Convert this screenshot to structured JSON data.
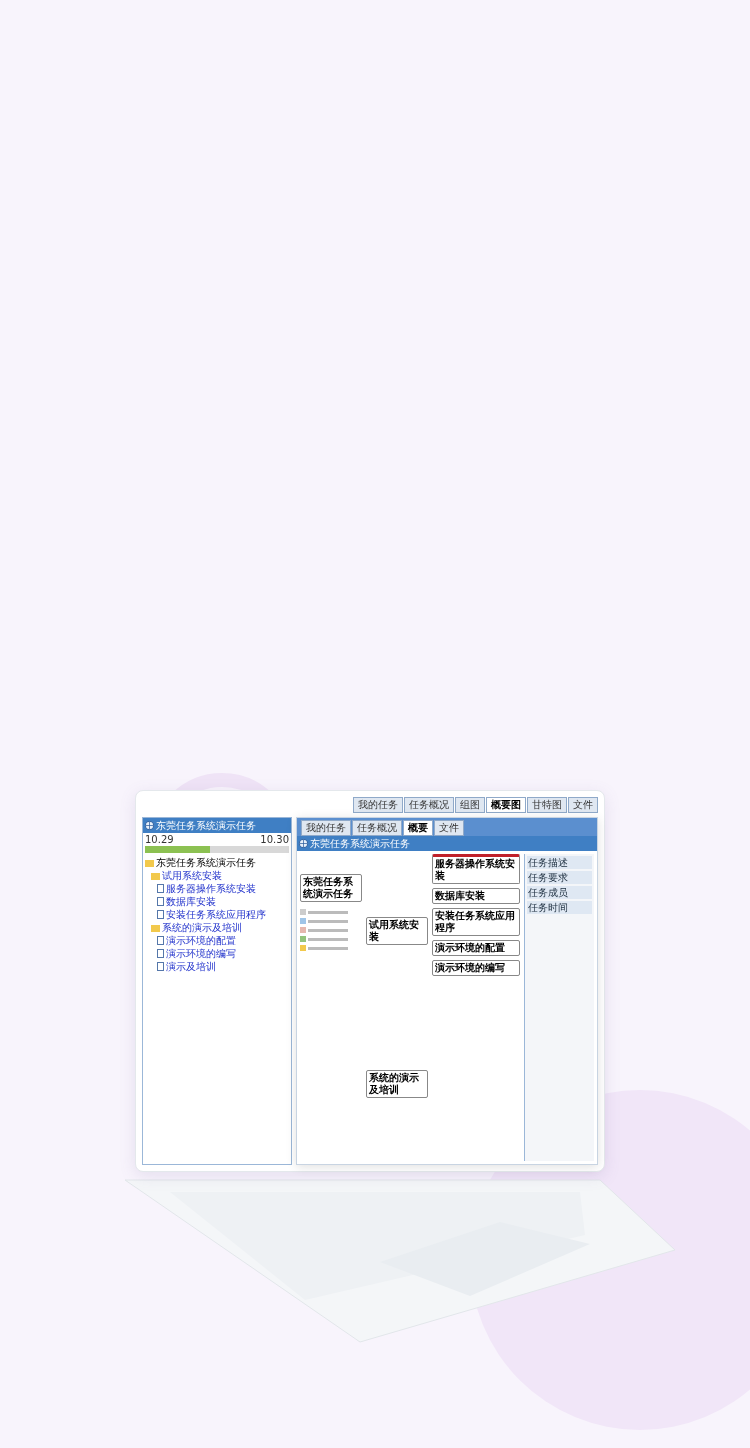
{
  "top_tabs": [
    {
      "label": "我的任务",
      "selected": false
    },
    {
      "label": "任务概况",
      "selected": false
    },
    {
      "label": "组图",
      "selected": false
    },
    {
      "label": "概要图",
      "selected": true
    },
    {
      "label": "甘特图",
      "selected": false
    },
    {
      "label": "文件",
      "selected": false
    }
  ],
  "main_window": {
    "title": "东莞任务系统演示任务",
    "dates": [
      "10.29",
      "10.30"
    ],
    "progress": {
      "level": 0.45
    },
    "tree": [
      {
        "label": "东莞任务系统演示任务",
        "children": [
          {
            "label": "试用系统安装",
            "children": [
              {
                "label": "服务器操作系统安装"
              },
              {
                "label": "数据库安装"
              },
              {
                "label": "安装任务系统应用程序"
              }
            ]
          },
          {
            "label": "系统的演示及培训",
            "children": [
              {
                "label": "演示环境的配置"
              },
              {
                "label": "演示环境的编写"
              },
              {
                "label": "演示及培训"
              }
            ]
          }
        ]
      }
    ]
  },
  "detail_window": {
    "title": "东莞任务系统演示任务",
    "tabs": [
      {
        "label": "我的任务",
        "selected": false
      },
      {
        "label": "任务概况",
        "selected": false
      },
      {
        "label": "概要",
        "selected": true
      },
      {
        "label": "文件",
        "selected": false
      }
    ],
    "root_node": "东莞任务系统演示任务",
    "nodes": [
      "试用系统安装",
      "系统的演示及培训"
    ],
    "leaf_nodes": [
      {
        "label": "服务器操作系统安装",
        "selected": true
      },
      {
        "label": "数据库安装",
        "selected": false
      },
      {
        "label": "安装任务系统应用程序",
        "selected": false
      },
      {
        "label": "演示环境的配置",
        "selected": false
      },
      {
        "label": "演示环境的编写",
        "selected": false
      }
    ],
    "side_labels": [
      "任务描述",
      "任务要求",
      "任务成员",
      "任务时间"
    ]
  }
}
